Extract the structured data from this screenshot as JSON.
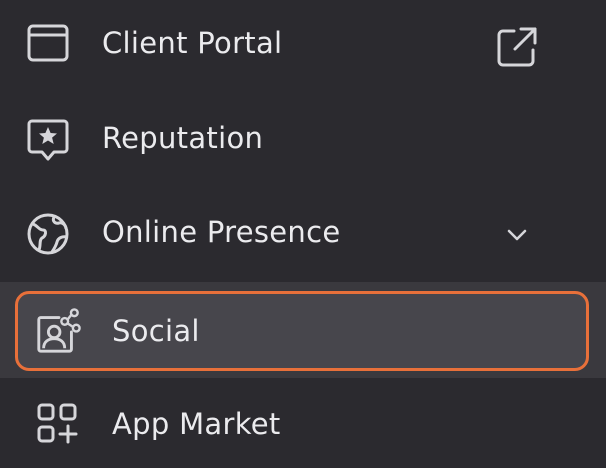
{
  "nav": {
    "items": [
      {
        "label": "Client Portal",
        "icon": "browser-window-icon",
        "trailing_icon": "external-link-icon"
      },
      {
        "label": "Reputation",
        "icon": "star-message-icon"
      },
      {
        "label": "Online Presence",
        "icon": "globe-icon",
        "trailing_icon": "chevron-down-icon"
      },
      {
        "label": "Social",
        "icon": "social-profile-share-icon",
        "selected": true
      },
      {
        "label": "App Market",
        "icon": "apps-grid-plus-icon"
      }
    ]
  },
  "colors": {
    "background": "#2b2a2f",
    "selected_row": "#3a393e",
    "selected_card": "#47464c",
    "accent_border": "#e8703a",
    "text": "#ebebee",
    "icon": "#d6d6da"
  }
}
